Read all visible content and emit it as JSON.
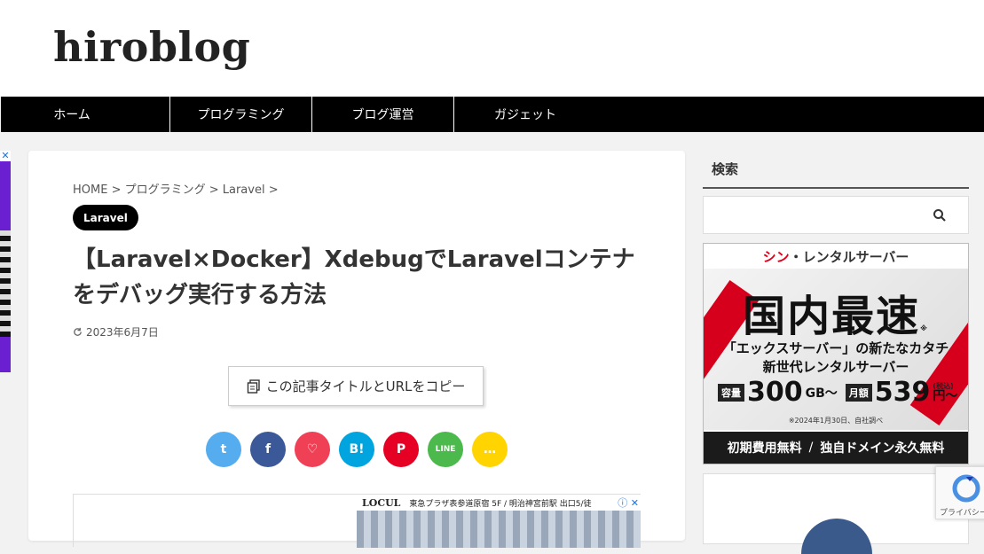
{
  "site": {
    "logo": "hiroblog"
  },
  "nav": {
    "items": [
      {
        "label": "ホーム"
      },
      {
        "label": "プログラミング"
      },
      {
        "label": "ブログ運営"
      },
      {
        "label": "ガジェット"
      }
    ]
  },
  "article": {
    "breadcrumb": "HOME > プログラミング > Laravel >",
    "category": "Laravel",
    "title": "【Laravel×Docker】XdebugでLaravelコンテナをデバッグ実行する方法",
    "updated": "2023年6月7日",
    "copy_button": "この記事タイトルとURLをコピー"
  },
  "share": [
    {
      "name": "twitter",
      "glyph": "t",
      "color": "#55acee"
    },
    {
      "name": "facebook",
      "glyph": "f",
      "color": "#3b5998"
    },
    {
      "name": "pocket",
      "glyph": "♡",
      "color": "#ef4056"
    },
    {
      "name": "hatena",
      "glyph": "B!",
      "color": "#00a4de"
    },
    {
      "name": "pinterest",
      "glyph": "P",
      "color": "#e60023"
    },
    {
      "name": "line",
      "glyph": "LINE",
      "color": "#4cb94c"
    },
    {
      "name": "comment",
      "glyph": "…",
      "color": "#ffd400"
    }
  ],
  "ad": {
    "brand": "LOCUL",
    "text": "東急プラザ表参道原宿 5F / 明治神宮前駅 出口5/徒"
  },
  "sidebar": {
    "search_title": "検索",
    "banner": {
      "brand_red": "シン",
      "brand_rest": "・レンタルサーバー",
      "headline": "国内最速",
      "mark": "※",
      "sub1": "「エックスサーバー」の新たなカタチ",
      "sub2": "新世代レンタルサーバー",
      "capacity_tag": "容量",
      "capacity": "300",
      "capacity_unit": "GB〜",
      "monthly_tag": "月額",
      "price": "539",
      "tax": "(税込)",
      "price_unit": "円〜",
      "note": "※2024年1月30日、自社調べ",
      "foot_left": "初期費用無料",
      "foot_sep": "/",
      "foot_right": "独自ドメイン永久無料"
    }
  },
  "recaptcha": {
    "text": "プライバシー・利用規約"
  }
}
